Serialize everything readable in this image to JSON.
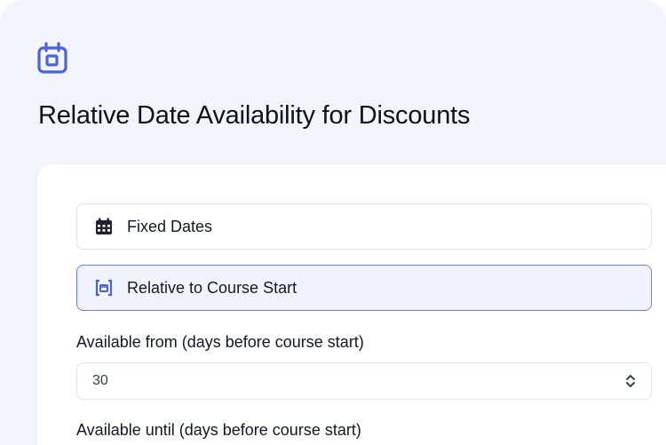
{
  "page": {
    "title": "Relative Date Availability for Discounts",
    "header_icon": "calendar-icon"
  },
  "options": [
    {
      "label": "Fixed Dates",
      "icon": "calendar-grid-icon",
      "selected": false
    },
    {
      "label": "Relative to Course Start",
      "icon": "calendar-bracket-icon",
      "selected": true
    }
  ],
  "fields": {
    "available_from": {
      "label": "Available from (days before course start)",
      "value": "30"
    },
    "available_until": {
      "label": "Available until (days before course start)"
    }
  },
  "colors": {
    "accent": "#4b63dd",
    "background": "#f3f5fd",
    "selected_bg": "#f1f4ff",
    "selected_border": "#6a80e6",
    "text": "#111827"
  }
}
